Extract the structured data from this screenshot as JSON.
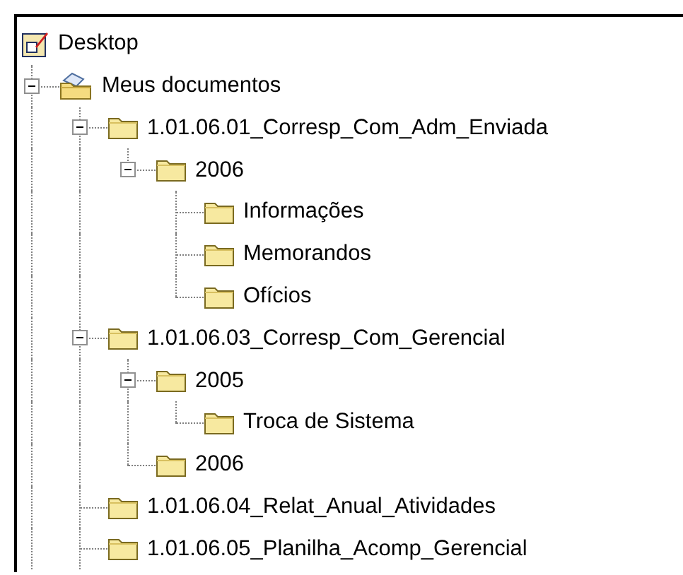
{
  "tree": {
    "label": "Desktop",
    "kind": "desktop",
    "children": [
      {
        "label": "Meus documentos",
        "kind": "documents",
        "expanded": true,
        "more_below": true,
        "children": [
          {
            "label": "1.01.06.01_Corresp_Com_Adm_Enviada",
            "kind": "folder",
            "expanded": true,
            "children": [
              {
                "label": "2006",
                "kind": "folder",
                "expanded": true,
                "children": [
                  {
                    "label": "Informações",
                    "kind": "folder"
                  },
                  {
                    "label": "Memorandos",
                    "kind": "folder"
                  },
                  {
                    "label": "Ofícios",
                    "kind": "folder"
                  }
                ]
              }
            ]
          },
          {
            "label": "1.01.06.03_Corresp_Com_Gerencial",
            "kind": "folder",
            "expanded": true,
            "children": [
              {
                "label": "2005",
                "kind": "folder",
                "expanded": true,
                "children": [
                  {
                    "label": "Troca de Sistema",
                    "kind": "folder"
                  }
                ]
              },
              {
                "label": "2006",
                "kind": "folder"
              }
            ]
          },
          {
            "label": "1.01.06.04_Relat_Anual_Atividades",
            "kind": "folder"
          },
          {
            "label": "1.01.06.05_Planilha_Acomp_Gerencial",
            "kind": "folder",
            "more_below": true
          }
        ]
      }
    ]
  }
}
